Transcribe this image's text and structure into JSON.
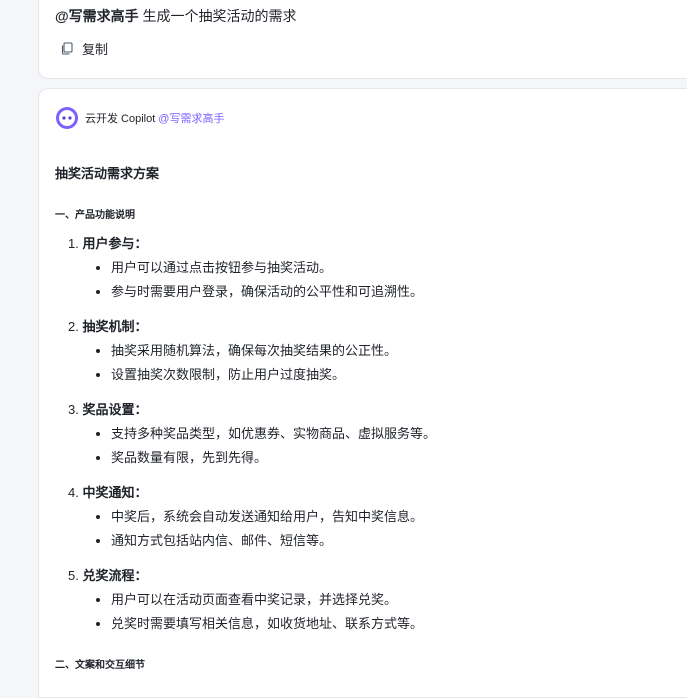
{
  "prompt": {
    "mention": "@写需求高手",
    "text": " 生成一个抽奖活动的需求",
    "copy_label": "复制"
  },
  "response": {
    "bot_name": "云开发 Copilot",
    "bot_mention": "@写需求高手",
    "title": "抽奖活动需求方案",
    "section1_title": "一、产品功能说明",
    "section2_title": "二、文案和交互细节",
    "items": [
      {
        "num": "1.",
        "title": "用户参与：",
        "bullets": [
          "用户可以通过点击按钮参与抽奖活动。",
          "参与时需要用户登录，确保活动的公平性和可追溯性。"
        ]
      },
      {
        "num": "2.",
        "title": "抽奖机制：",
        "bullets": [
          "抽奖采用随机算法，确保每次抽奖结果的公正性。",
          "设置抽奖次数限制，防止用户过度抽奖。"
        ]
      },
      {
        "num": "3.",
        "title": "奖品设置：",
        "bullets": [
          "支持多种奖品类型，如优惠券、实物商品、虚拟服务等。",
          "奖品数量有限，先到先得。"
        ]
      },
      {
        "num": "4.",
        "title": "中奖通知：",
        "bullets": [
          "中奖后，系统会自动发送通知给用户，告知中奖信息。",
          "通知方式包括站内信、邮件、短信等。"
        ]
      },
      {
        "num": "5.",
        "title": "兑奖流程：",
        "bullets": [
          "用户可以在活动页面查看中奖记录，并选择兑奖。",
          "兑奖时需要填写相关信息，如收货地址、联系方式等。"
        ]
      }
    ]
  },
  "icons": {
    "copy": "copy-icon",
    "avatar": "copilot-avatar-icon"
  },
  "colors": {
    "mention": "#7b61ff",
    "avatar_ring": "#7b61ff"
  }
}
